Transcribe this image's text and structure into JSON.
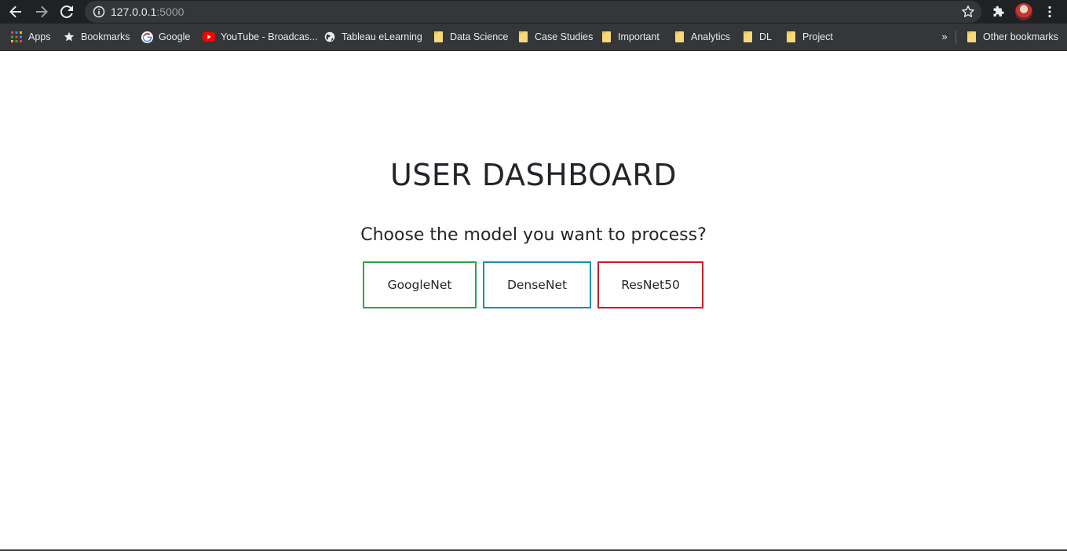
{
  "browser": {
    "url_host": "127.0.0.1",
    "url_port": ":5000",
    "bookmarks": [
      {
        "label": "Apps",
        "icon": "apps-grid-icon"
      },
      {
        "label": "Bookmarks",
        "icon": "star-icon"
      },
      {
        "label": "Google",
        "icon": "google-icon"
      },
      {
        "label": "YouTube - Broadcas...",
        "icon": "youtube-icon"
      },
      {
        "label": "Tableau eLearning",
        "icon": "globe-icon"
      },
      {
        "label": "Data Science",
        "icon": "folder-icon"
      },
      {
        "label": "Case Studies",
        "icon": "folder-icon"
      },
      {
        "label": "Important",
        "icon": "folder-icon"
      },
      {
        "label": "Analytics",
        "icon": "folder-icon"
      },
      {
        "label": "DL",
        "icon": "folder-icon"
      },
      {
        "label": "Project",
        "icon": "folder-icon"
      }
    ],
    "overflow_chevron": "»",
    "other_bookmarks": "Other bookmarks"
  },
  "page": {
    "title": "USER DASHBOARD",
    "subtitle": "Choose the model you want to process?",
    "buttons": [
      {
        "label": "GoogleNet",
        "border_color": "#28a745"
      },
      {
        "label": "DenseNet",
        "border_color": "#1591aa"
      },
      {
        "label": "ResNet50",
        "border_color": "#cc1c25"
      }
    ]
  },
  "colors": {
    "chrome_dark": "#202124",
    "bookmark_bar": "#35363a",
    "text_light": "#e8eaed",
    "page_text": "#212529"
  }
}
